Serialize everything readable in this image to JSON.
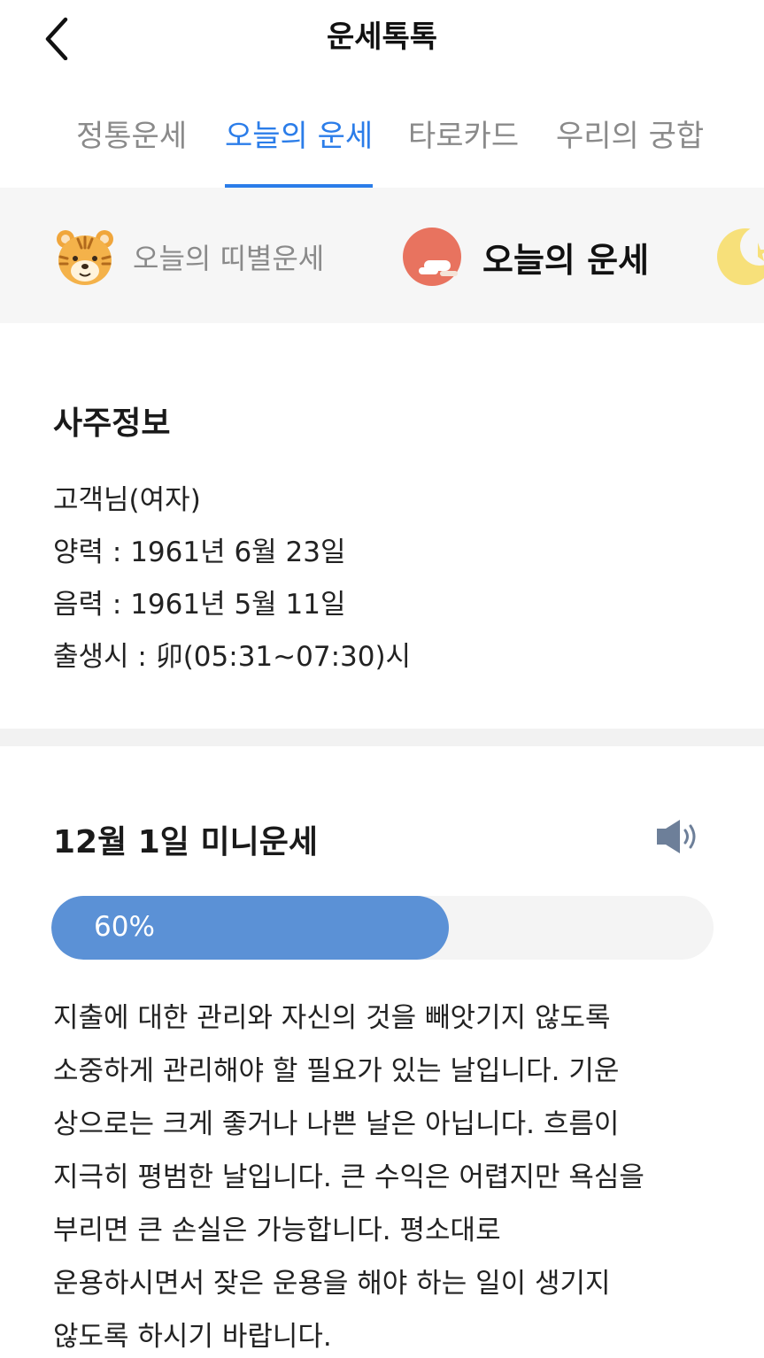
{
  "header": {
    "title": "운세톡톡",
    "back_icon": "chevron-left-icon"
  },
  "tabs": [
    {
      "label": "정통운세",
      "active": false
    },
    {
      "label": "오늘의 운세",
      "active": true
    },
    {
      "label": "타로카드",
      "active": false
    },
    {
      "label": "우리의 궁합",
      "active": false
    }
  ],
  "subnav": [
    {
      "label": "오늘의 띠별운세",
      "icon": "tiger-icon",
      "active": false
    },
    {
      "label": "오늘의 운세",
      "icon": "sun-cloud-icon",
      "active": true
    },
    {
      "label": "",
      "icon": "moon-icon",
      "active": false
    }
  ],
  "saju": {
    "title": "사주정보",
    "name": "고객님(여자)",
    "solar": "양력 : 1961년 6월 23일",
    "lunar": "음력 : 1961년 5월 11일",
    "birth_time": "출생시 : 卯(05:31~07:30)시"
  },
  "mini": {
    "title": "12월 1일 미니운세",
    "speaker_icon": "speaker-icon",
    "progress": 0.6,
    "progress_label": "60%",
    "lines": [
      "지출에 대한 관리와 자신의 것을 빼앗기지 않도록",
      "소중하게 관리해야 할 필요가 있는 날입니다. 기운",
      "상으로는 크게 좋거나 나쁜 날은 아닙니다. 흐름이",
      "지극히 평범한 날입니다. 큰 수익은 어렵지만 욕심을",
      "부리면 큰 손실은 가능합니다. 평소대로",
      "운용하시면서 잦은 운용을 해야 하는 일이 생기지",
      "않도록 하시기 바랍니다."
    ]
  },
  "colors": {
    "accent": "#2b7de9",
    "progress": "#5b91d6",
    "inactive": "#8a8a8a"
  }
}
